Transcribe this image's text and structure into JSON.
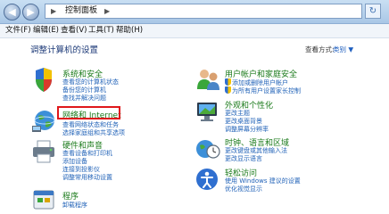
{
  "titlebar": {
    "back_glyph": "◀",
    "forward_glyph": "▶",
    "address_arrow": "▶",
    "breadcrumb": "控制面板",
    "breadcrumb_arrow": "▶",
    "refresh_glyph": "↻"
  },
  "menu": {
    "file": "文件(F)",
    "edit": "编辑(E)",
    "view": "查看(V)",
    "tools": "工具(T)",
    "help": "帮助(H)"
  },
  "page": {
    "heading": "调整计算机的设置",
    "view_by_label": "查看方式:",
    "view_by_value": "类别 ▼"
  },
  "categories": [
    {
      "id": "system-security",
      "title": "系统和安全",
      "links": [
        "查看您的计算机状态",
        "备份您的计算机",
        "查找并解决问题"
      ]
    },
    {
      "id": "network-internet",
      "title": "网络和 Internet",
      "links": [
        "查看网络状态和任务",
        "选择家庭组和共享选项"
      ]
    },
    {
      "id": "hardware-sound",
      "title": "硬件和声音",
      "links": [
        "查看设备和打印机",
        "添加设备",
        "连接到投影仪",
        "调整常用移动设置"
      ]
    },
    {
      "id": "programs",
      "title": "程序",
      "links": [
        "卸载程序"
      ]
    },
    {
      "id": "user-accounts",
      "title": "用户帐户和家庭安全",
      "links": [
        "添加或删除用户帐户",
        "为所有用户设置家长控制"
      ]
    },
    {
      "id": "appearance",
      "title": "外观和个性化",
      "links": [
        "更改主题",
        "更改桌面背景",
        "调整屏幕分辨率"
      ]
    },
    {
      "id": "clock-language",
      "title": "时钟、语言和区域",
      "links": [
        "更改键盘或其他输入法",
        "更改显示语言"
      ]
    },
    {
      "id": "ease-of-access",
      "title": "轻松访问",
      "links": [
        "使用 Windows 建议的设置",
        "优化视觉显示"
      ]
    }
  ],
  "colors": {
    "category_title": "#1a7a1a",
    "link": "#2263b8",
    "highlight_border": "#e0171b",
    "titlebar": "#b8d2ed"
  },
  "icons": {
    "system_security": "shield-flag-icon",
    "network": "globe-network-icon",
    "hardware": "printer-icon",
    "programs": "programs-icon",
    "users": "users-icon",
    "appearance": "monitor-paint-icon",
    "clock": "clock-globe-icon",
    "ease": "ease-of-access-icon",
    "uac_shield": "uac-shield-icon"
  }
}
